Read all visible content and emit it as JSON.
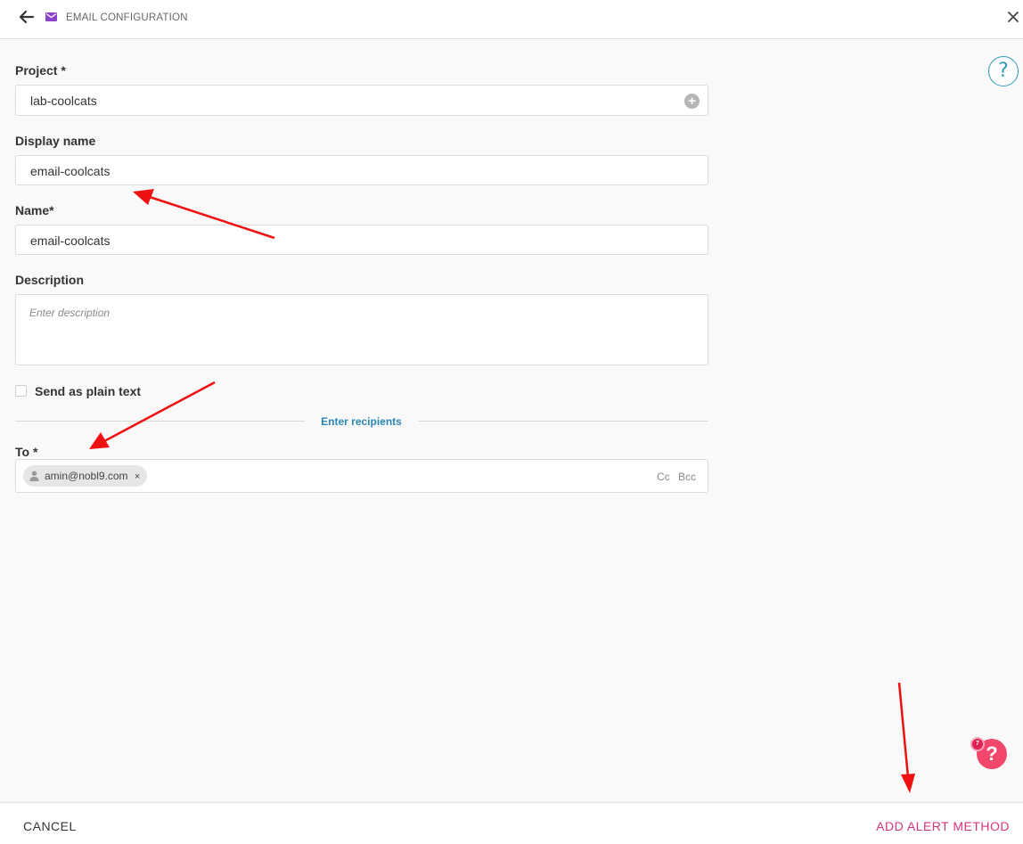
{
  "header": {
    "title": "EMAIL CONFIGURATION",
    "back_icon": "arrow-left-icon",
    "mail_icon": "envelope-icon",
    "close_icon": "close-icon",
    "mail_icon_color": "#8b44c8"
  },
  "form": {
    "project": {
      "label": "Project *",
      "value": "lab-coolcats"
    },
    "display_name": {
      "label": "Display name",
      "value": "email-coolcats"
    },
    "name": {
      "label": "Name*",
      "value": "email-coolcats"
    },
    "description": {
      "label": "Description",
      "value": "",
      "placeholder": "Enter description"
    },
    "plain_text": {
      "label": "Send as plain text",
      "checked": false
    },
    "recipients_divider": "Enter recipients",
    "to": {
      "label": "To *",
      "recipients": [
        "amin@nobl9.com"
      ],
      "chip_remove": "×",
      "cc_label": "Cc",
      "bcc_label": "Bcc"
    }
  },
  "help": {
    "icon": "question-circle-icon",
    "glyph": "?"
  },
  "support": {
    "glyph": "?",
    "badge_count": "7",
    "color": "#f0476a"
  },
  "footer": {
    "cancel_label": "CANCEL",
    "add_label": "ADD ALERT METHOD",
    "add_color": "#d6357b"
  },
  "annotations": {
    "arrow_color": "#ee1111"
  }
}
